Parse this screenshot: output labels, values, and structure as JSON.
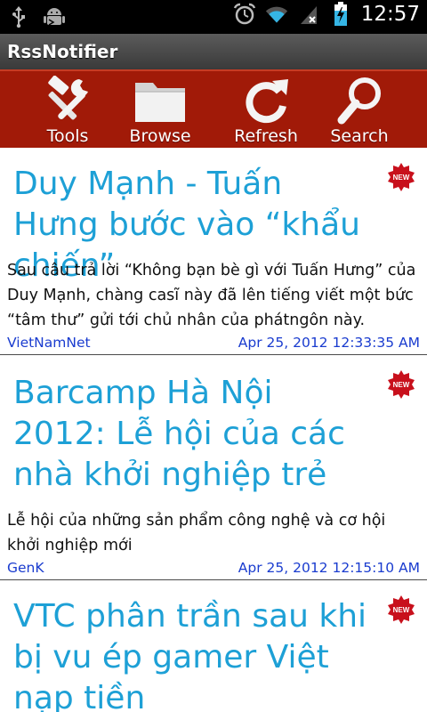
{
  "status_bar": {
    "time": "12:57",
    "icons": [
      "usb-icon",
      "android-debug-icon",
      "alarm-icon",
      "wifi-icon",
      "no-signal-icon",
      "battery-charging-icon"
    ]
  },
  "app": {
    "title": "RssNotifier"
  },
  "toolbar": {
    "tools_label": "Tools",
    "browse_label": "Browse",
    "refresh_label": "Refresh",
    "search_label": "Search"
  },
  "colors": {
    "toolbar_bg": "#a11a08",
    "headline": "#1da0d6",
    "meta": "#1a3ccf",
    "new_badge": "#c8101c"
  },
  "feed": {
    "items": [
      {
        "headline": "Duy Mạnh - Tuấn Hưng bước vào “khẩu chiến”",
        "summary": "Sau câu trả lời “Không bạn bè gì với Tuấn Hưng” của Duy Mạnh, chàng casĩ này đã lên tiếng viết một bức “tâm thư” gửi tới chủ nhân của phátngôn này.",
        "source": "VietNamNet",
        "date": "Apr 25, 2012 12:33:35 AM",
        "badge": "NEW"
      },
      {
        "headline": "Barcamp Hà Nội 2012: Lễ hội của các nhà khởi nghiệp trẻ",
        "summary": "Lễ hội của những sản phẩm công nghệ và cơ hội khởi nghiệp mới",
        "source": "GenK",
        "date": "Apr 25, 2012 12:15:10 AM",
        "badge": "NEW"
      },
      {
        "headline": "VTC phân trần sau khi bị vu ép gamer Việt nạp tiền",
        "badge": "NEW"
      }
    ]
  }
}
